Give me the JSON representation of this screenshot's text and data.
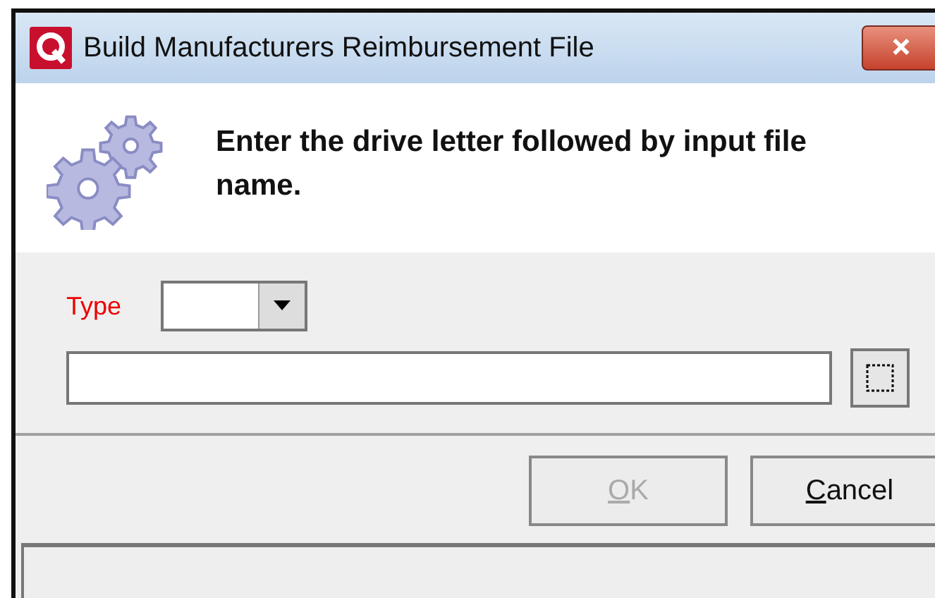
{
  "window": {
    "title": "Build Manufacturers Reimbursement File"
  },
  "header": {
    "message": "Enter the drive letter followed by input file name."
  },
  "form": {
    "type_label": "Type",
    "type_required": true
  },
  "buttons": [
    {
      "label": "OK",
      "disabled": true
    },
    {
      "label": "Cancel",
      "disabled": false
    }
  ]
}
